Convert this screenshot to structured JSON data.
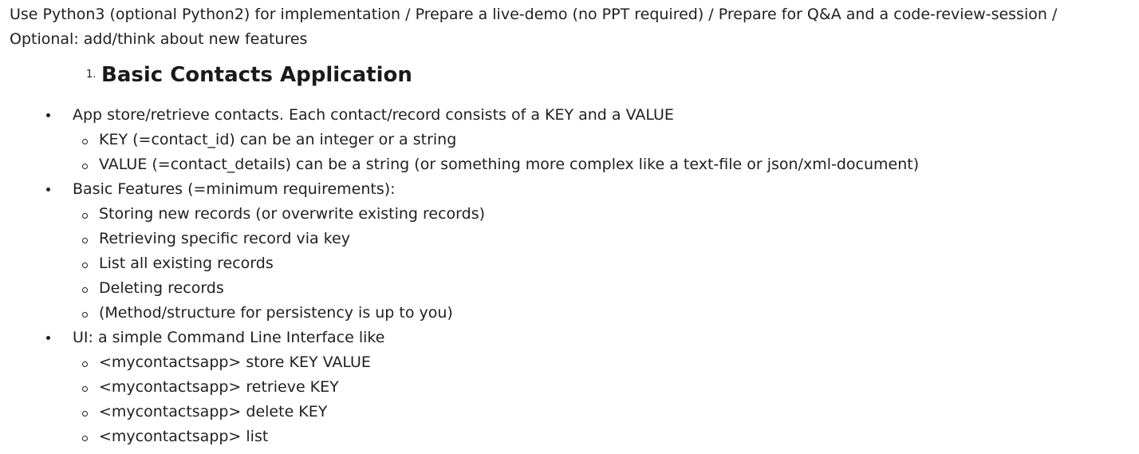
{
  "intro": {
    "line1": "Use Python3 (optional Python2) for implementation / Prepare a live-demo (no PPT required) / Prepare for Q&A and a code-review-session /",
    "line2": "Optional: add/think about new features"
  },
  "heading": {
    "number": "1.",
    "title": "Basic Contacts Application"
  },
  "sections": [
    {
      "text": "App store/retrieve contacts. Each contact/record consists of a KEY and a VALUE",
      "items": [
        "KEY (=contact_id) can be an integer or a string",
        "VALUE (=contact_details) can be a string (or something more complex like a text-file or json/xml-document)"
      ]
    },
    {
      "text": "Basic Features (=minimum requirements):",
      "items": [
        "Storing new records (or overwrite existing records)",
        "Retrieving specific record via key",
        "List all existing records",
        "Deleting records",
        "(Method/structure for persistency is up to you)"
      ]
    },
    {
      "text": "UI: a simple Command Line Interface like",
      "items": [
        "<mycontactsapp> store KEY VALUE",
        "<mycontactsapp> retrieve KEY",
        "<mycontactsapp> delete KEY",
        "<mycontactsapp> list"
      ]
    }
  ]
}
